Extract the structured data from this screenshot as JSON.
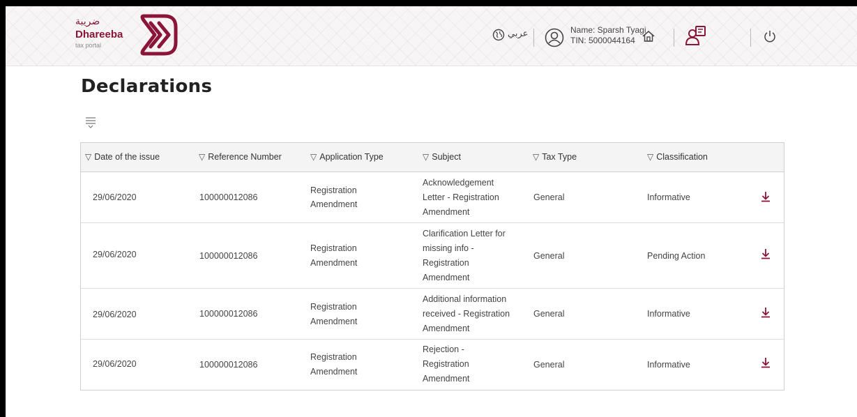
{
  "header": {
    "logo_ar": "ضريبة",
    "logo_en": "Dhareeba",
    "logo_sub": "tax portal",
    "language_link": "عربي",
    "user_name": "Name: Sparsh Tyagi",
    "user_tin": "TIN: 5000044164"
  },
  "page": {
    "title": "Declarations"
  },
  "table": {
    "columns": [
      "Date of the issue",
      "Reference Number",
      "Application Type",
      "Subject",
      "Tax Type",
      "Classification"
    ],
    "rows": [
      {
        "date": "29/06/2020",
        "reference": "100000012086",
        "app_type_1": "Registration",
        "app_type_2": "Amendment",
        "subject_1": "Acknowledgement",
        "subject_2": "Letter - Registration",
        "subject_3": "Amendment",
        "subject_4": "",
        "tax_type": "General",
        "classification": "Informative"
      },
      {
        "date": "29/06/2020",
        "reference": "100000012086",
        "app_type_1": "Registration",
        "app_type_2": "Amendment",
        "subject_1": "Clarification Letter for",
        "subject_2": "missing info -",
        "subject_3": "Registration",
        "subject_4": "Amendment",
        "tax_type": "General",
        "classification": "Pending Action"
      },
      {
        "date": "29/06/2020",
        "reference": "100000012086",
        "app_type_1": "Registration",
        "app_type_2": "Amendment",
        "subject_1": "Additional information",
        "subject_2": "received - Registration",
        "subject_3": "Amendment",
        "subject_4": "",
        "tax_type": "General",
        "classification": "Informative"
      },
      {
        "date": "29/06/2020",
        "reference": "100000012086",
        "app_type_1": "Registration",
        "app_type_2": "Amendment",
        "subject_1": "Rejection -",
        "subject_2": "Registration",
        "subject_3": "Amendment",
        "subject_4": "",
        "tax_type": "General",
        "classification": "Informative"
      }
    ]
  },
  "colors": {
    "brand": "#8a1538",
    "header_bg": "#f7f5f5",
    "table_header_bg": "#f4f4f4"
  },
  "icons": {
    "globe": "globe-icon",
    "user": "user-icon",
    "home": "home-icon",
    "switch": "switch-account-icon",
    "power": "power-icon",
    "filter": "filter-icon",
    "download": "download-icon"
  }
}
